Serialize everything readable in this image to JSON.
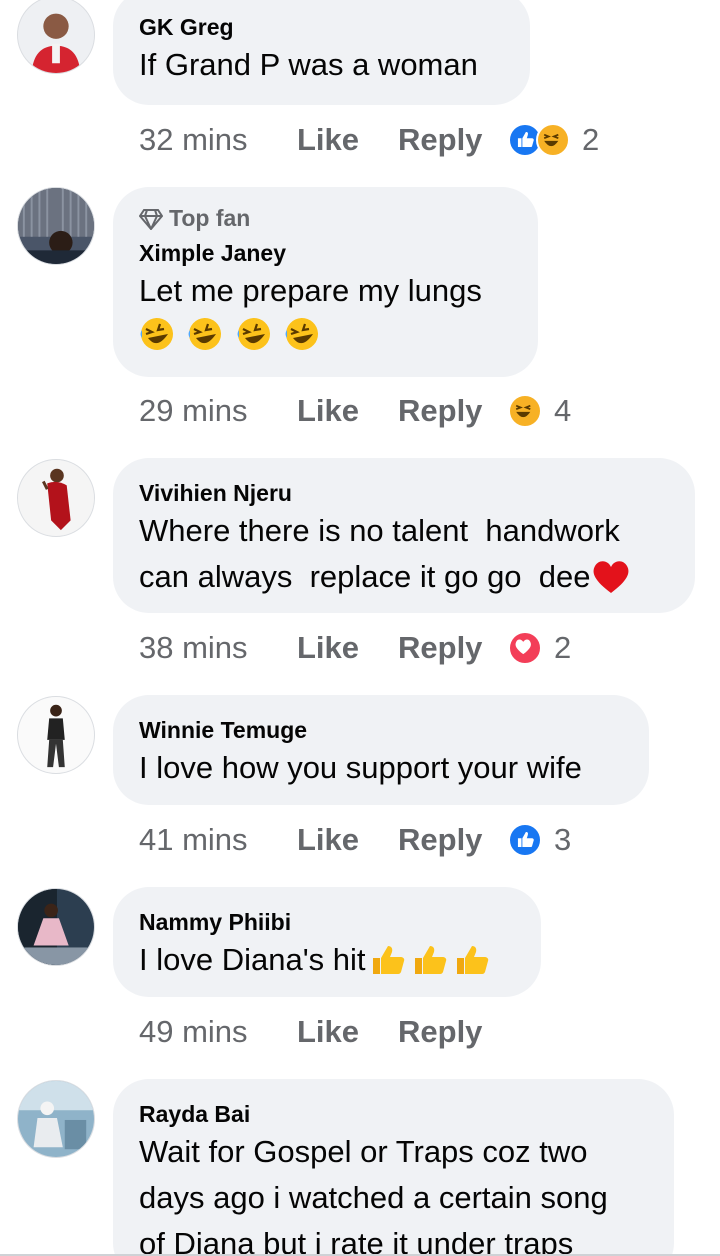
{
  "comments": [
    {
      "author": "GK Greg",
      "text": "If Grand P was a woman",
      "time": "32 mins",
      "like": "Like",
      "reply": "Reply",
      "reactions": [
        "like",
        "haha"
      ],
      "reaction_count": "2"
    },
    {
      "badge": "Top fan",
      "author": "Ximple Janey",
      "text": "Let me prepare my lungs",
      "emoji_line": [
        "rofl",
        "rofl",
        "rofl",
        "rofl"
      ],
      "time": "29 mins",
      "like": "Like",
      "reply": "Reply",
      "reactions": [
        "haha"
      ],
      "reaction_count": "4"
    },
    {
      "author": "Vivihien Njeru",
      "text_line1": "Where there is no talent  handwork",
      "text_line2": "can always  replace it go go  dee",
      "trailing_emoji": "red-heart",
      "time": "38 mins",
      "like": "Like",
      "reply": "Reply",
      "reactions": [
        "love"
      ],
      "reaction_count": "2"
    },
    {
      "author": "Winnie Temuge",
      "text": "I love how you support your wife",
      "time": "41 mins",
      "like": "Like",
      "reply": "Reply",
      "reactions": [
        "like"
      ],
      "reaction_count": "3"
    },
    {
      "author": "Nammy Phiibi",
      "text": "I love Diana's hit",
      "trailing_emoji": [
        "thumbs-up",
        "thumbs-up",
        "thumbs-up"
      ],
      "time": "49 mins",
      "like": "Like",
      "reply": "Reply"
    },
    {
      "author": "Rayda Bai",
      "text_line1": "Wait for Gospel or Traps coz two",
      "text_line2": "days ago i watched a certain song",
      "text_line3": "of Diana but i rate it under traps"
    }
  ],
  "colors": {
    "bubble": "#f0f2f5",
    "meta_text": "#65676b",
    "like_blue": "#1877f2",
    "love_red": "#f33e58",
    "haha_yellow": "#f7b125"
  }
}
